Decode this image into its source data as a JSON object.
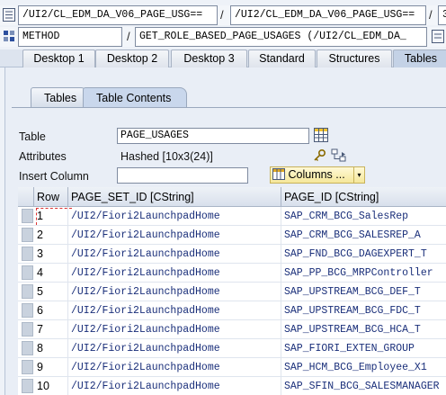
{
  "path": {
    "row1": {
      "field1": "/UI2/CL_EDM_DA_V06_PAGE_USG==",
      "sep1": "/",
      "field2": "/UI2/CL_EDM_DA_V06_PAGE_USG==",
      "sep2": "/",
      "field3": "3"
    },
    "row2": {
      "field1": "METHOD",
      "sep1": "/",
      "field2": "GET_ROLE_BASED_PAGE_USAGES (/UI2/CL_EDM_DA_"
    }
  },
  "outer_tabs": [
    "Desktop 1",
    "Desktop 2",
    "Desktop 3",
    "Standard",
    "Structures",
    "Tables"
  ],
  "outer_active": "Tables",
  "inner_tabs": [
    "Tables",
    "Table Contents"
  ],
  "inner_active": "Table Contents",
  "form": {
    "table_label": "Table",
    "table_value": "PAGE_USAGES",
    "attributes_label": "Attributes",
    "attributes_value": "Hashed [10x3(24)]",
    "insert_column_label": "Insert Column",
    "insert_column_value": "",
    "columns_button": "Columns ..."
  },
  "grid": {
    "headers": [
      "Row",
      "PAGE_SET_ID [CString]",
      "PAGE_ID [CString]"
    ],
    "rows": [
      {
        "row": "1",
        "page_set_id": "/UI2/Fiori2LaunchpadHome",
        "page_id": "SAP_CRM_BCG_SalesRep"
      },
      {
        "row": "2",
        "page_set_id": "/UI2/Fiori2LaunchpadHome",
        "page_id": "SAP_CRM_BCG_SALESREP_A"
      },
      {
        "row": "3",
        "page_set_id": "/UI2/Fiori2LaunchpadHome",
        "page_id": "SAP_FND_BCG_DAGEXPERT_T"
      },
      {
        "row": "4",
        "page_set_id": "/UI2/Fiori2LaunchpadHome",
        "page_id": "SAP_PP_BCG_MRPController"
      },
      {
        "row": "5",
        "page_set_id": "/UI2/Fiori2LaunchpadHome",
        "page_id": "SAP_UPSTREAM_BCG_DEF_T"
      },
      {
        "row": "6",
        "page_set_id": "/UI2/Fiori2LaunchpadHome",
        "page_id": "SAP_UPSTREAM_BCG_FDC_T"
      },
      {
        "row": "7",
        "page_set_id": "/UI2/Fiori2LaunchpadHome",
        "page_id": "SAP_UPSTREAM_BCG_HCA_T"
      },
      {
        "row": "8",
        "page_set_id": "/UI2/Fiori2LaunchpadHome",
        "page_id": "SAP_FIORI_EXTEN_GROUP"
      },
      {
        "row": "9",
        "page_set_id": "/UI2/Fiori2LaunchpadHome",
        "page_id": "SAP_HCM_BCG_Employee_X1"
      },
      {
        "row": "10",
        "page_set_id": "/UI2/Fiori2LaunchpadHome",
        "page_id": "SAP_SFIN_BCG_SALESMANAGER"
      }
    ]
  },
  "colors": {
    "value_text": "#1a2f7a",
    "tab_active": "#c4d2e6",
    "columns_button": "#f5e79a"
  }
}
